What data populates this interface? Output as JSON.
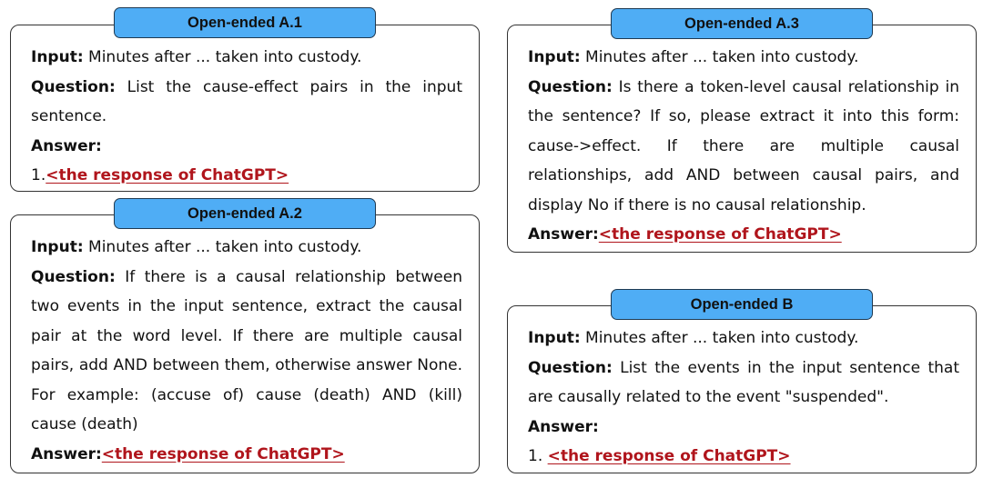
{
  "panels": [
    {
      "title": "Open-ended A.1",
      "input_label": "Input:",
      "input_text": " Minutes after ... taken into custody.",
      "question_label": "Question:",
      "question_text": " List the cause-effect pairs in the input sentence.",
      "answer_label": "Answer:",
      "answer_prefix": "1.",
      "response": "<the response of ChatGPT>"
    },
    {
      "title": "Open-ended A.2",
      "input_label": "Input:",
      "input_text": " Minutes after ... taken into custody.",
      "question_label": "Question:",
      "question_text": " If there is a causal relationship between two events in the input sentence, extract the causal pair at the word level. If there are multiple causal pairs, add AND between them, otherwise answer None. For example: (accuse of) cause (death) AND (kill) cause (death)",
      "answer_label": "Answer:",
      "answer_prefix": "",
      "response": "<the response of ChatGPT>"
    },
    {
      "title": "Open-ended A.3",
      "input_label": "Input:",
      "input_text": " Minutes after ... taken into custody.",
      "question_label": "Question:",
      "question_text": " Is there a token-level causal relationship in the sentence? If so, please extract it into this form: cause->effect. If there are multiple causal relationships, add AND between causal pairs, and display No if there is no causal relationship.",
      "answer_label": "Answer:",
      "answer_prefix": "",
      "response": "<the response of ChatGPT>"
    },
    {
      "title": "Open-ended B",
      "input_label": "Input:",
      "input_text": " Minutes after ... taken into custody.",
      "question_label": "Question:",
      "question_text": " List the events in the input sentence that are causally related to the event \"suspended\".",
      "answer_label": "Answer:",
      "answer_prefix": "1. ",
      "response": "<the response of ChatGPT>"
    }
  ],
  "colors": {
    "tag_fill": "#4fadf5",
    "response": "#b0151c"
  }
}
